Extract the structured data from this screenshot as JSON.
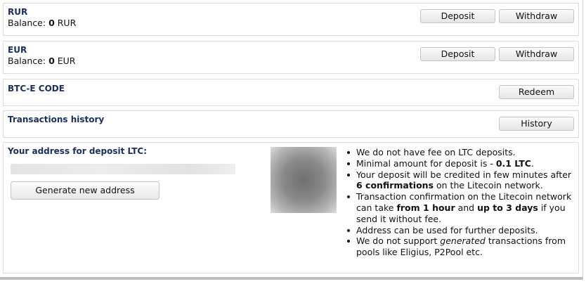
{
  "rur": {
    "title": "RUR",
    "balance_label": "Balance:",
    "balance_value": "0",
    "currency": "RUR",
    "deposit_label": "Deposit",
    "withdraw_label": "Withdraw"
  },
  "eur": {
    "title": "EUR",
    "balance_label": "Balance:",
    "balance_value": "0",
    "currency": "EUR",
    "deposit_label": "Deposit",
    "withdraw_label": "Withdraw"
  },
  "code": {
    "title": "BTC-E CODE",
    "redeem_label": "Redeem"
  },
  "history": {
    "title": "Transactions history",
    "button_label": "History"
  },
  "deposit_ltc": {
    "title": "Your address for deposit LTC:",
    "generate_label": "Generate new address",
    "notes": {
      "n1": "We do not have fee on LTC deposits.",
      "n2_a": "Minimal amount for deposit is - ",
      "n2_b": "0.1 LTC",
      "n2_c": ".",
      "n3_a": "Your deposit will be credited in few minutes after ",
      "n3_b": "6 confirmations",
      "n3_c": " on the Litecoin network.",
      "n4_a": "Transaction confirmation on the Litecoin network can take ",
      "n4_b": "from 1 hour",
      "n4_c": " and ",
      "n4_d": "up to 3 days",
      "n4_e": " if you send it without fee.",
      "n5": "Address can be used for further deposits.",
      "n6_a": "We do not support ",
      "n6_b": "generated",
      "n6_c": " transactions from pools like Eligius, P2Pool etc."
    }
  }
}
